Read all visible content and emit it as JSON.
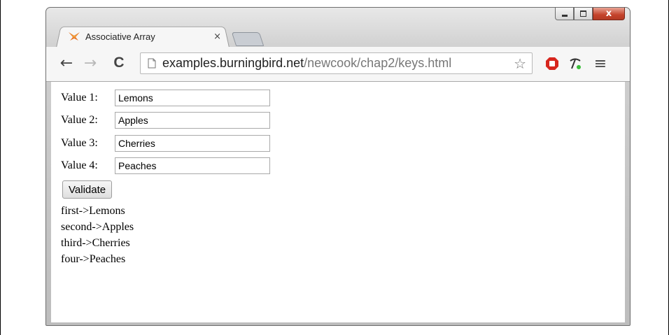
{
  "window": {
    "controls": {
      "minimize": "minimize",
      "maximize": "maximize",
      "close": "x"
    }
  },
  "tab": {
    "title": "Associative Array",
    "close_glyph": "×"
  },
  "toolbar": {
    "back_glyph": "←",
    "forward_glyph": "→",
    "reload_glyph": "C",
    "url_host": "examples.burningbird.net",
    "url_path": "/newcook/chap2/keys.html",
    "star_glyph": "☆",
    "menu_glyph": "≡"
  },
  "form": {
    "fields": [
      {
        "label": "Value 1:",
        "value": "Lemons"
      },
      {
        "label": "Value 2:",
        "value": "Apples"
      },
      {
        "label": "Value 3:",
        "value": "Cherries"
      },
      {
        "label": "Value 4:",
        "value": "Peaches"
      }
    ],
    "validate_label": "Validate"
  },
  "results": [
    "first->Lemons",
    "second->Apples",
    "third->Cherries",
    "four->Peaches"
  ],
  "colors": {
    "accent_close": "#c4432b",
    "page_bg": "#ffffff",
    "chrome_bg": "#f6f6f6"
  },
  "icons": {
    "tab": "firefox-like-favicon",
    "page": "page-icon",
    "ext1": "stop-sign-icon",
    "ext2": "pickaxe-icon",
    "menu": "hamburger-menu-icon"
  }
}
